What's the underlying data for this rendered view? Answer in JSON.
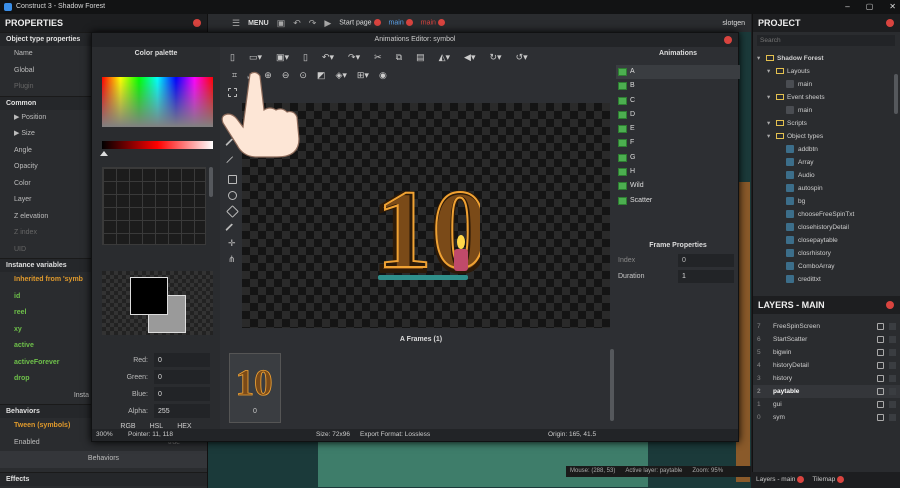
{
  "window": {
    "title": "Construct 3 - Shadow Forest"
  },
  "properties": {
    "title": "PROPERTIES",
    "sections": [
      {
        "label": "Object type properties",
        "rows": [
          "Name",
          "Global",
          "Plugin"
        ]
      },
      {
        "label": "Common",
        "rows": [
          "Position",
          "Size",
          "Angle",
          "Opacity",
          "Color",
          "Layer",
          "Z elevation",
          "Z index",
          "UID"
        ]
      },
      {
        "label": "Instance variables",
        "rows": [
          "Inherited from 'symb",
          "id",
          "reel",
          "xy",
          "active",
          "activeForever",
          "drop"
        ]
      },
      {
        "label": "Behaviors",
        "rows": [
          "Tween (symbols)",
          "Enabled"
        ]
      },
      {
        "label": "Effects",
        "rows": []
      }
    ],
    "instance_label": "Insta",
    "enabled_value": "true",
    "behaviors_button": "Behaviors"
  },
  "toolbar": {
    "menu": "MENU",
    "start_page": "Start page",
    "main_tab": "main",
    "main_tab2": "main",
    "user": "slotgen"
  },
  "project": {
    "title": "PROJECT",
    "search_placeholder": "Search",
    "items": [
      {
        "label": "Shadow Forest",
        "level": 0,
        "type": "root"
      },
      {
        "label": "Layouts",
        "level": 1,
        "type": "folder"
      },
      {
        "label": "main",
        "level": 2,
        "type": "item"
      },
      {
        "label": "Event sheets",
        "level": 1,
        "type": "folder"
      },
      {
        "label": "main",
        "level": 2,
        "type": "item"
      },
      {
        "label": "Scripts",
        "level": 1,
        "type": "folder"
      },
      {
        "label": "Object types",
        "level": 1,
        "type": "folder"
      },
      {
        "label": "addbtn",
        "level": 2,
        "type": "obj"
      },
      {
        "label": "Array",
        "level": 2,
        "type": "obj"
      },
      {
        "label": "Audio",
        "level": 2,
        "type": "obj"
      },
      {
        "label": "autospin",
        "level": 2,
        "type": "obj"
      },
      {
        "label": "bg",
        "level": 2,
        "type": "obj"
      },
      {
        "label": "chooseFreeSpinTxt",
        "level": 2,
        "type": "obj"
      },
      {
        "label": "closehistoryDetail",
        "level": 2,
        "type": "obj"
      },
      {
        "label": "closepaytable",
        "level": 2,
        "type": "obj"
      },
      {
        "label": "closrhistory",
        "level": 2,
        "type": "obj"
      },
      {
        "label": "ComboArray",
        "level": 2,
        "type": "obj"
      },
      {
        "label": "credittxt",
        "level": 2,
        "type": "obj"
      }
    ]
  },
  "layers": {
    "title": "LAYERS - MAIN",
    "rows": [
      {
        "num": "7",
        "label": "FreeSpinScreen"
      },
      {
        "num": "6",
        "label": "StartScatter"
      },
      {
        "num": "5",
        "label": "bigwin"
      },
      {
        "num": "4",
        "label": "historyDetail"
      },
      {
        "num": "3",
        "label": "history"
      },
      {
        "num": "2",
        "label": "paytable",
        "selected": true
      },
      {
        "num": "1",
        "label": "gui"
      },
      {
        "num": "0",
        "label": "sym"
      }
    ],
    "tab_active": "Layers - main",
    "tab_other": "Tilemap"
  },
  "status": {
    "mouse": "Mouse: (288, 53)",
    "active_layer": "Active layer: paytable",
    "zoom": "Zoom: 95%"
  },
  "editor": {
    "title": "Animations Editor: symbol",
    "color_palette": "Color palette",
    "channels": [
      {
        "label": "Red:",
        "value": "0"
      },
      {
        "label": "Green:",
        "value": "0"
      },
      {
        "label": "Blue:",
        "value": "0"
      },
      {
        "label": "Alpha:",
        "value": "255"
      }
    ],
    "color_modes": [
      "RGB",
      "HSL",
      "HEX"
    ],
    "animations_title": "Animations",
    "animations": [
      "A",
      "B",
      "C",
      "D",
      "E",
      "F",
      "G",
      "H",
      "Wild",
      "Scatter"
    ],
    "frame_properties_title": "Frame Properties",
    "frame_props": [
      {
        "label": "Index",
        "value": "0"
      },
      {
        "label": "Duration",
        "value": "1"
      }
    ],
    "frames_title": "A Frames (1)",
    "frame_index": "0",
    "zoom": "300%",
    "pointer": "Pointer: 11, 118",
    "size": "Size: 72x96",
    "export": "Export Format: Lossless",
    "origin": "Origin: 165, 41.5",
    "sprite_text": "10"
  },
  "colors": {
    "accent_red": "#d9443f",
    "green_label": "#6ec04a",
    "orange_label": "#e09a2c",
    "folder": "#e3c04f"
  }
}
